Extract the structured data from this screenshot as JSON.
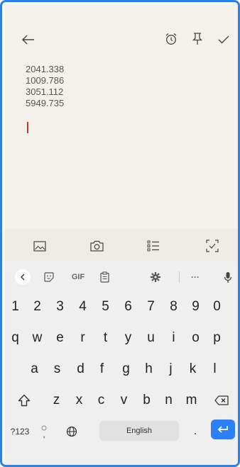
{
  "note": {
    "lines": [
      "2041.338",
      "1009.786",
      "3051.112",
      "5949.735"
    ]
  },
  "topbar": {
    "icons": [
      "back-arrow-icon",
      "alarm-clock-icon",
      "pin-icon",
      "checkmark-icon"
    ]
  },
  "mediabar": {
    "icons": [
      "image-icon",
      "camera-icon",
      "checklist-icon",
      "scan-icon"
    ]
  },
  "keyboard": {
    "toolbar": {
      "gif_label": "GIF",
      "more_label": "···"
    },
    "row_numbers": [
      "1",
      "2",
      "3",
      "4",
      "5",
      "6",
      "7",
      "8",
      "9",
      "0"
    ],
    "row_q": [
      "q",
      "w",
      "e",
      "r",
      "t",
      "y",
      "u",
      "i",
      "o",
      "p"
    ],
    "row_a": [
      "a",
      "s",
      "d",
      "f",
      "g",
      "h",
      "j",
      "k",
      "l"
    ],
    "row_z": [
      "z",
      "x",
      "c",
      "v",
      "b",
      "n",
      "m"
    ],
    "bottom": {
      "symbols_label": "?123",
      "comma_label": ",",
      "space_label": "English",
      "period_label": "."
    },
    "colors": {
      "accent": "#2d7ff9",
      "border": "#2f7fe0"
    }
  }
}
